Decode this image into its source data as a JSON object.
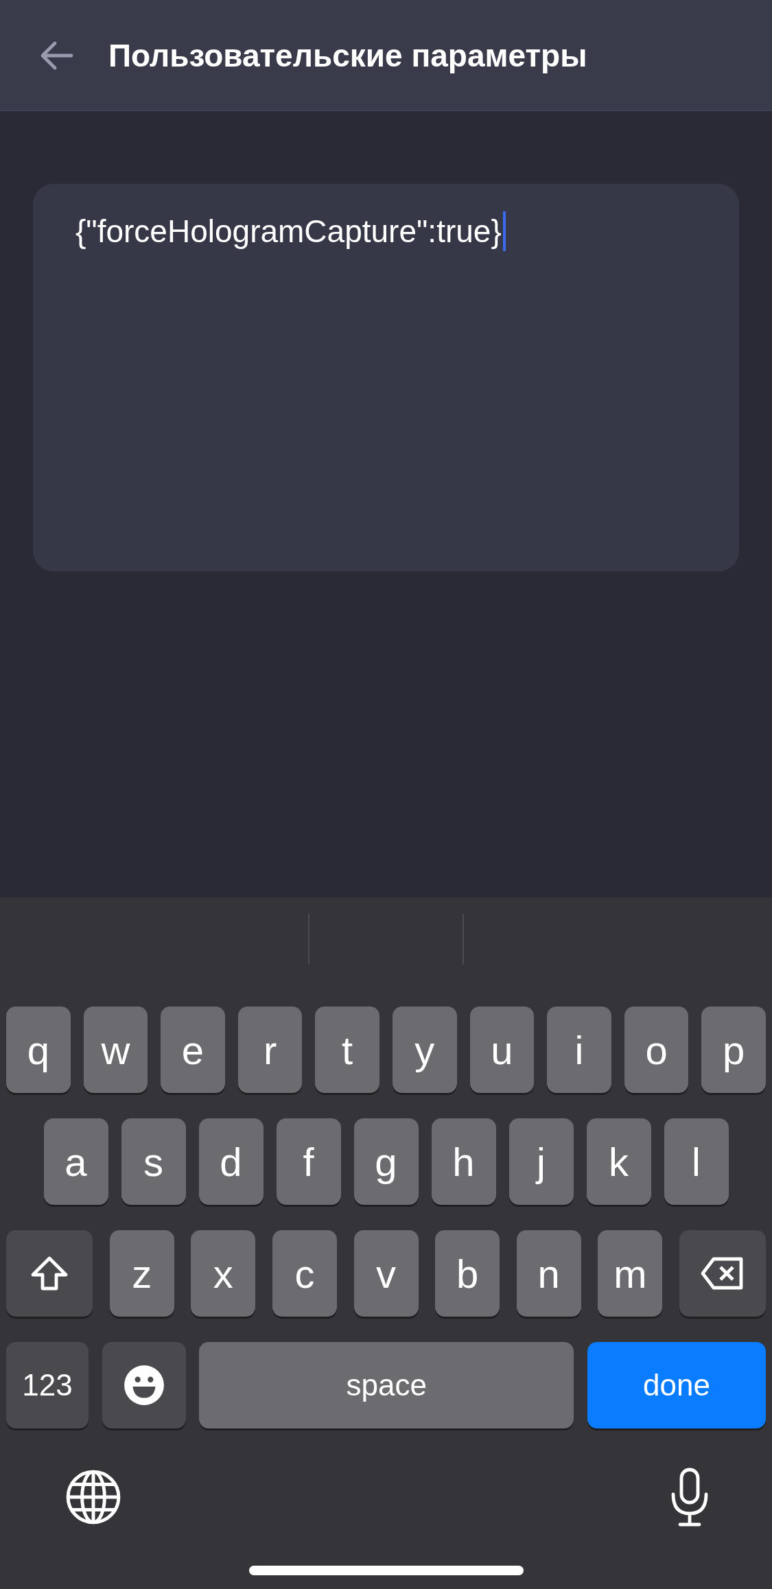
{
  "header": {
    "title": "Пользовательские параметры"
  },
  "editor": {
    "value": "{\"forceHologramCapture\":true}",
    "focused": true
  },
  "keyboard": {
    "rows": [
      {
        "keys": [
          {
            "kind": "letter",
            "label": "q"
          },
          {
            "kind": "letter",
            "label": "w"
          },
          {
            "kind": "letter",
            "label": "e"
          },
          {
            "kind": "letter",
            "label": "r"
          },
          {
            "kind": "letter",
            "label": "t"
          },
          {
            "kind": "letter",
            "label": "y"
          },
          {
            "kind": "letter",
            "label": "u"
          },
          {
            "kind": "letter",
            "label": "i"
          },
          {
            "kind": "letter",
            "label": "o"
          },
          {
            "kind": "letter",
            "label": "p"
          }
        ]
      },
      {
        "keys": [
          {
            "kind": "letter",
            "label": "a"
          },
          {
            "kind": "letter",
            "label": "s"
          },
          {
            "kind": "letter",
            "label": "d"
          },
          {
            "kind": "letter",
            "label": "f"
          },
          {
            "kind": "letter",
            "label": "g"
          },
          {
            "kind": "letter",
            "label": "h"
          },
          {
            "kind": "letter",
            "label": "j"
          },
          {
            "kind": "letter",
            "label": "k"
          },
          {
            "kind": "letter",
            "label": "l"
          }
        ]
      },
      {
        "keys": [
          {
            "kind": "shift"
          },
          {
            "kind": "letter",
            "label": "z"
          },
          {
            "kind": "letter",
            "label": "x"
          },
          {
            "kind": "letter",
            "label": "c"
          },
          {
            "kind": "letter",
            "label": "v"
          },
          {
            "kind": "letter",
            "label": "b"
          },
          {
            "kind": "letter",
            "label": "n"
          },
          {
            "kind": "letter",
            "label": "m"
          },
          {
            "kind": "backspace"
          }
        ]
      },
      {
        "keys": [
          {
            "kind": "numbers",
            "label": "123"
          },
          {
            "kind": "emoji"
          },
          {
            "kind": "space",
            "label": "space"
          },
          {
            "kind": "done",
            "label": "done"
          }
        ]
      }
    ]
  }
}
